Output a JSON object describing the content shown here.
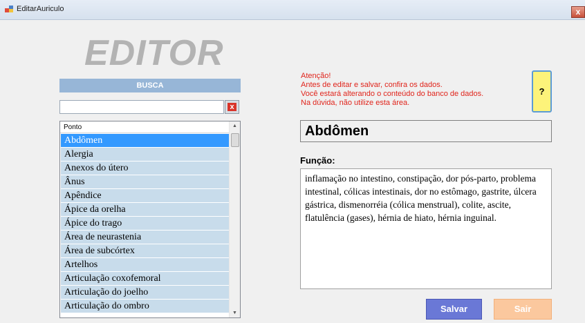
{
  "window": {
    "title": "EditarAuriculo",
    "close_label": "x"
  },
  "logo": {
    "text": "EDITOR"
  },
  "search": {
    "header": "BUSCA",
    "value": "",
    "clear_label": "x"
  },
  "list": {
    "column_header": "Ponto",
    "selected_index": 0,
    "items": [
      "Abdômen",
      "Alergia",
      "Anexos do útero",
      "Ânus",
      "Apêndice",
      "Ápice da orelha",
      "Ápice do trago",
      "Área de neurastenia",
      "Área de subcórtex",
      "Artelhos",
      "Articulação coxofemoral",
      "Articulação do joelho",
      "Articulação do ombro"
    ]
  },
  "warning": {
    "lines": [
      "Atenção!",
      "Antes de editar e salvar, confira os dados.",
      "Você estará alterando o conteúdo do banco de dados.",
      "Na dúvida, não utilize esta área."
    ]
  },
  "help": {
    "label": "?"
  },
  "detail": {
    "point_name": "Abdômen",
    "funcao_label": "Função:",
    "funcao_text": "inflamação no intestino, constipação, dor pós-parto, problema intestinal, cólicas intestinais, dor no estômago, gastrite, úlcera gástrica,  dismenorréia (cólica menstrual), colite, ascite, flatulência (gases), hérnia de hiato, hérnia inguinal."
  },
  "buttons": {
    "save_label": "Salvar",
    "exit_label": "Sair"
  },
  "colors": {
    "warning_text": "#e0241b",
    "list_row_bg": "#c8dceb",
    "list_selected_bg": "#3399ff",
    "save_button": "#6a78d6",
    "exit_button": "#fbc89e",
    "help_button": "#fdf37a"
  }
}
